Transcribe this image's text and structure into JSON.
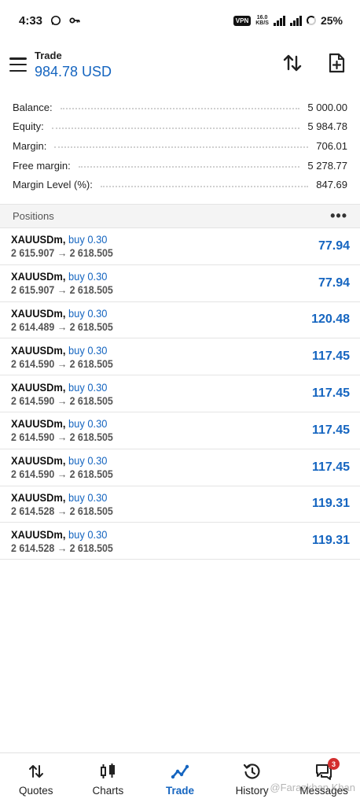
{
  "status_bar": {
    "time": "4:33",
    "vpn": "VPN",
    "net_speed": "16.0",
    "net_unit": "KB/S",
    "battery": "25%"
  },
  "header": {
    "title": "Trade",
    "subtitle": "984.78 USD",
    "icons": [
      "sort-arrows-icon",
      "new-order-icon"
    ]
  },
  "summary": [
    {
      "label": "Balance:",
      "value": "5 000.00"
    },
    {
      "label": "Equity:",
      "value": "5 984.78"
    },
    {
      "label": "Margin:",
      "value": "706.01"
    },
    {
      "label": "Free margin:",
      "value": "5 278.77"
    },
    {
      "label": "Margin Level (%):",
      "value": "847.69"
    }
  ],
  "positions": {
    "title": "Positions",
    "more": "•••",
    "rows": [
      {
        "symbol": "XAUUSDm,",
        "type": "buy 0.30",
        "prices": "2 615.907 → 2 618.505",
        "profit": "77.94"
      },
      {
        "symbol": "XAUUSDm,",
        "type": "buy 0.30",
        "prices": "2 615.907 → 2 618.505",
        "profit": "77.94"
      },
      {
        "symbol": "XAUUSDm,",
        "type": "buy 0.30",
        "prices": "2 614.489 → 2 618.505",
        "profit": "120.48"
      },
      {
        "symbol": "XAUUSDm,",
        "type": "buy 0.30",
        "prices": "2 614.590 → 2 618.505",
        "profit": "117.45"
      },
      {
        "symbol": "XAUUSDm,",
        "type": "buy 0.30",
        "prices": "2 614.590 → 2 618.505",
        "profit": "117.45"
      },
      {
        "symbol": "XAUUSDm,",
        "type": "buy 0.30",
        "prices": "2 614.590 → 2 618.505",
        "profit": "117.45"
      },
      {
        "symbol": "XAUUSDm,",
        "type": "buy 0.30",
        "prices": "2 614.590 → 2 618.505",
        "profit": "117.45"
      },
      {
        "symbol": "XAUUSDm,",
        "type": "buy 0.30",
        "prices": "2 614.528 → 2 618.505",
        "profit": "119.31"
      },
      {
        "symbol": "XAUUSDm,",
        "type": "buy 0.30",
        "prices": "2 614.528 → 2 618.505",
        "profit": "119.31"
      }
    ]
  },
  "bottom_nav": {
    "items": [
      {
        "label": "Quotes",
        "icon": "quotes-icon"
      },
      {
        "label": "Charts",
        "icon": "charts-icon"
      },
      {
        "label": "Trade",
        "icon": "trade-icon",
        "active": true
      },
      {
        "label": "History",
        "icon": "history-icon"
      },
      {
        "label": "Messages",
        "icon": "messages-icon",
        "badge": "3"
      }
    ]
  },
  "watermark": "@Farazkhan Khan",
  "colors": {
    "accent": "#1565c0",
    "badge": "#d32f2f"
  }
}
